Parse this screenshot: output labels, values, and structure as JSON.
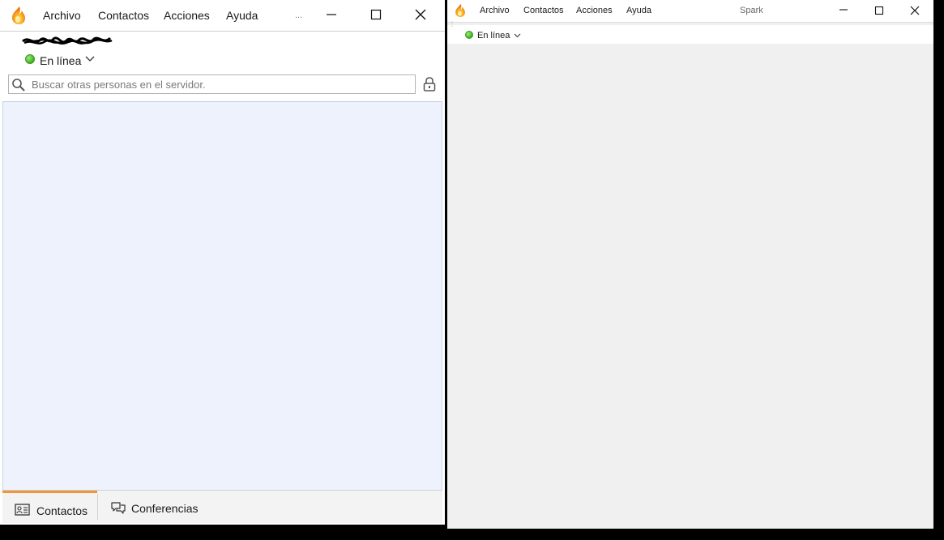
{
  "window1": {
    "menu": [
      "Archivo",
      "Contactos",
      "Acciones",
      "Ayuda"
    ],
    "menu_more": "...",
    "status": "En línea",
    "search": {
      "placeholder": "Buscar otras personas en el servidor."
    },
    "tabs": [
      {
        "label": "Contactos",
        "active": true
      },
      {
        "label": "Conferencias",
        "active": false
      }
    ]
  },
  "window2": {
    "menu": [
      "Archivo",
      "Contactos",
      "Acciones",
      "Ayuda"
    ],
    "title": "Spark",
    "status": "En línea"
  },
  "colors": {
    "accent_tab": "#f0953a",
    "status_online": "#3fae20",
    "contact_list_bg": "#edf2fd"
  },
  "icons": [
    "spark-logo-icon",
    "minimize-icon",
    "maximize-icon",
    "close-icon",
    "status-online-icon",
    "chevron-down-icon",
    "search-icon",
    "lock-icon",
    "contacts-card-icon",
    "conference-chat-icon"
  ]
}
